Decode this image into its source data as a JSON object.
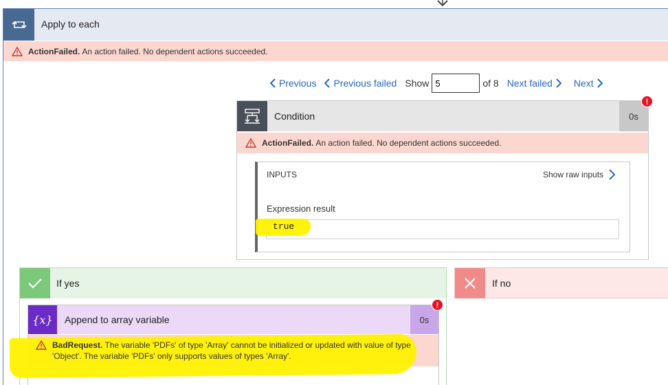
{
  "apply_to_each": {
    "title": "Apply to each",
    "error_code": "ActionFailed.",
    "error_message": "An action failed. No dependent actions succeeded."
  },
  "pager": {
    "previous_label": "Previous",
    "previous_failed_label": "Previous failed",
    "show_label": "Show",
    "current_value": "5",
    "of_label": "of 8",
    "next_failed_label": "Next failed",
    "next_label": "Next"
  },
  "condition": {
    "title": "Condition",
    "duration": "0s",
    "badge": "!",
    "error_code": "ActionFailed.",
    "error_message": "An action failed. No dependent actions succeeded.",
    "inputs_label": "INPUTS",
    "show_raw_inputs_label": "Show raw inputs",
    "expression_label": "Expression result",
    "expression_value": "true"
  },
  "if_yes": {
    "title": "If yes"
  },
  "if_no": {
    "title": "If no"
  },
  "append_action": {
    "icon_text": "{x}",
    "title": "Append to array variable",
    "duration": "0s",
    "badge": "!",
    "error_code": "BadRequest.",
    "error_message": "The variable 'PDFs' of type 'Array' cannot be initialized or updated with value of type 'Object'. The variable 'PDFs' only supports values of types 'Array'."
  },
  "colors": {
    "link": "#2467c4",
    "error_bg": "#fcd7cf",
    "loop_icon_bg": "#486991",
    "condition_icon_bg": "#484f58",
    "yes_icon_bg": "#7cc97c",
    "no_icon_bg": "#f08b8b",
    "variable_icon_bg": "#6b2bc7",
    "highlight": "#fff200",
    "error_badge": "#e81123"
  }
}
